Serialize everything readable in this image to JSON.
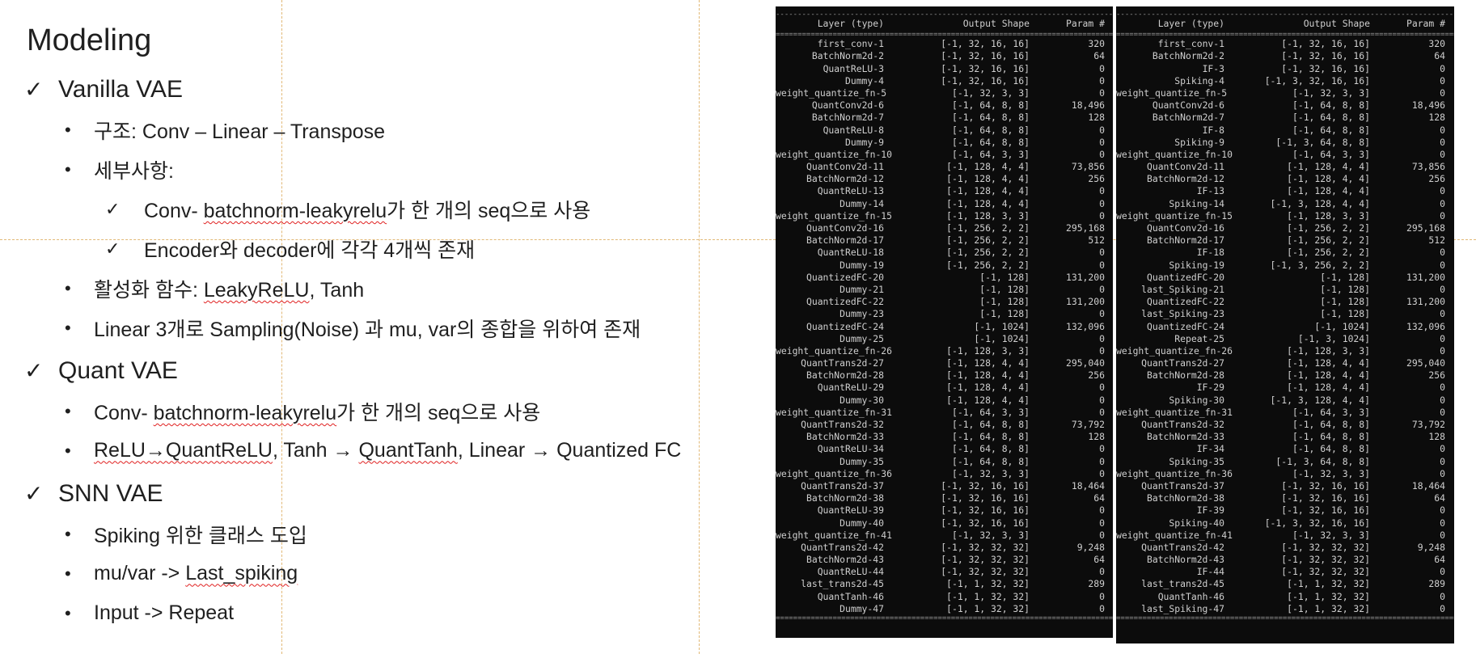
{
  "slide": {
    "title": "Modeling",
    "vanilla": {
      "heading": "Vanilla VAE",
      "structure_label": "구조: Conv – Linear – Transpose",
      "details_label": "세부사항:",
      "detail1_pre": "Conv- ",
      "detail1_sq": "batchnorm-leakyrelu",
      "detail1_post": "가 한 개의 seq으로 사용",
      "detail2": "Encoder와 decoder에 각각 4개씩 존재",
      "activation_pre": "활성화 함수: ",
      "activation_sq": "LeakyReLU",
      "activation_post": ", Tanh",
      "linear": "Linear 3개로  Sampling(Noise) 과 mu, var의 종합을 위하여 존재"
    },
    "quant": {
      "heading": "Quant VAE",
      "item1_pre": "Conv- ",
      "item1_sq": "batchnorm-leakyrelu",
      "item1_post": "가 한 개의 seq으로 사용",
      "item2_sq1": "ReLU→QuantReLU",
      "item2_mid": ", Tanh → ",
      "item2_sq2": "QuantTanh",
      "item2_post": ", Linear → Quantized FC"
    },
    "snn": {
      "heading": "SNN VAE",
      "item1": "Spiking 위한 클래스 도입",
      "item2_pre": "mu/var -> ",
      "item2_sq": "Last_spiking",
      "item3": "Input -> Repeat"
    }
  },
  "icons": {
    "check": "check-icon",
    "bullet": "bullet-icon"
  },
  "term_header": {
    "layer": "Layer (type)",
    "shape": "Output Shape",
    "params": "Param #"
  },
  "term_left": [
    [
      "first_conv-1",
      "[-1, 32, 16, 16]",
      "320"
    ],
    [
      "BatchNorm2d-2",
      "[-1, 32, 16, 16]",
      "64"
    ],
    [
      "QuantReLU-3",
      "[-1, 32, 16, 16]",
      "0"
    ],
    [
      "Dummy-4",
      "[-1, 32, 16, 16]",
      "0"
    ],
    [
      "weight_quantize_fn-5",
      "[-1, 32, 3, 3]",
      "0"
    ],
    [
      "QuantConv2d-6",
      "[-1, 64, 8, 8]",
      "18,496"
    ],
    [
      "BatchNorm2d-7",
      "[-1, 64, 8, 8]",
      "128"
    ],
    [
      "QuantReLU-8",
      "[-1, 64, 8, 8]",
      "0"
    ],
    [
      "Dummy-9",
      "[-1, 64, 8, 8]",
      "0"
    ],
    [
      "weight_quantize_fn-10",
      "[-1, 64, 3, 3]",
      "0"
    ],
    [
      "QuantConv2d-11",
      "[-1, 128, 4, 4]",
      "73,856"
    ],
    [
      "BatchNorm2d-12",
      "[-1, 128, 4, 4]",
      "256"
    ],
    [
      "QuantReLU-13",
      "[-1, 128, 4, 4]",
      "0"
    ],
    [
      "Dummy-14",
      "[-1, 128, 4, 4]",
      "0"
    ],
    [
      "weight_quantize_fn-15",
      "[-1, 128, 3, 3]",
      "0"
    ],
    [
      "QuantConv2d-16",
      "[-1, 256, 2, 2]",
      "295,168"
    ],
    [
      "BatchNorm2d-17",
      "[-1, 256, 2, 2]",
      "512"
    ],
    [
      "QuantReLU-18",
      "[-1, 256, 2, 2]",
      "0"
    ],
    [
      "Dummy-19",
      "[-1, 256, 2, 2]",
      "0"
    ],
    [
      "QuantizedFC-20",
      "[-1, 128]",
      "131,200"
    ],
    [
      "Dummy-21",
      "[-1, 128]",
      "0"
    ],
    [
      "QuantizedFC-22",
      "[-1, 128]",
      "131,200"
    ],
    [
      "Dummy-23",
      "[-1, 128]",
      "0"
    ],
    [
      "QuantizedFC-24",
      "[-1, 1024]",
      "132,096"
    ],
    [
      "Dummy-25",
      "[-1, 1024]",
      "0"
    ],
    [
      "weight_quantize_fn-26",
      "[-1, 128, 3, 3]",
      "0"
    ],
    [
      "QuantTrans2d-27",
      "[-1, 128, 4, 4]",
      "295,040"
    ],
    [
      "BatchNorm2d-28",
      "[-1, 128, 4, 4]",
      "256"
    ],
    [
      "QuantReLU-29",
      "[-1, 128, 4, 4]",
      "0"
    ],
    [
      "Dummy-30",
      "[-1, 128, 4, 4]",
      "0"
    ],
    [
      "weight_quantize_fn-31",
      "[-1, 64, 3, 3]",
      "0"
    ],
    [
      "QuantTrans2d-32",
      "[-1, 64, 8, 8]",
      "73,792"
    ],
    [
      "BatchNorm2d-33",
      "[-1, 64, 8, 8]",
      "128"
    ],
    [
      "QuantReLU-34",
      "[-1, 64, 8, 8]",
      "0"
    ],
    [
      "Dummy-35",
      "[-1, 64, 8, 8]",
      "0"
    ],
    [
      "weight_quantize_fn-36",
      "[-1, 32, 3, 3]",
      "0"
    ],
    [
      "QuantTrans2d-37",
      "[-1, 32, 16, 16]",
      "18,464"
    ],
    [
      "BatchNorm2d-38",
      "[-1, 32, 16, 16]",
      "64"
    ],
    [
      "QuantReLU-39",
      "[-1, 32, 16, 16]",
      "0"
    ],
    [
      "Dummy-40",
      "[-1, 32, 16, 16]",
      "0"
    ],
    [
      "weight_quantize_fn-41",
      "[-1, 32, 3, 3]",
      "0"
    ],
    [
      "QuantTrans2d-42",
      "[-1, 32, 32, 32]",
      "9,248"
    ],
    [
      "BatchNorm2d-43",
      "[-1, 32, 32, 32]",
      "64"
    ],
    [
      "QuantReLU-44",
      "[-1, 32, 32, 32]",
      "0"
    ],
    [
      "last_trans2d-45",
      "[-1, 1, 32, 32]",
      "289"
    ],
    [
      "QuantTanh-46",
      "[-1, 1, 32, 32]",
      "0"
    ],
    [
      "Dummy-47",
      "[-1, 1, 32, 32]",
      "0"
    ]
  ],
  "term_right": [
    [
      "first_conv-1",
      "[-1, 32, 16, 16]",
      "320"
    ],
    [
      "BatchNorm2d-2",
      "[-1, 32, 16, 16]",
      "64"
    ],
    [
      "IF-3",
      "[-1, 32, 16, 16]",
      "0"
    ],
    [
      "Spiking-4",
      "[-1, 3, 32, 16, 16]",
      "0"
    ],
    [
      "weight_quantize_fn-5",
      "[-1, 32, 3, 3]",
      "0"
    ],
    [
      "QuantConv2d-6",
      "[-1, 64, 8, 8]",
      "18,496"
    ],
    [
      "BatchNorm2d-7",
      "[-1, 64, 8, 8]",
      "128"
    ],
    [
      "IF-8",
      "[-1, 64, 8, 8]",
      "0"
    ],
    [
      "Spiking-9",
      "[-1, 3, 64, 8, 8]",
      "0"
    ],
    [
      "weight_quantize_fn-10",
      "[-1, 64, 3, 3]",
      "0"
    ],
    [
      "QuantConv2d-11",
      "[-1, 128, 4, 4]",
      "73,856"
    ],
    [
      "BatchNorm2d-12",
      "[-1, 128, 4, 4]",
      "256"
    ],
    [
      "IF-13",
      "[-1, 128, 4, 4]",
      "0"
    ],
    [
      "Spiking-14",
      "[-1, 3, 128, 4, 4]",
      "0"
    ],
    [
      "weight_quantize_fn-15",
      "[-1, 128, 3, 3]",
      "0"
    ],
    [
      "QuantConv2d-16",
      "[-1, 256, 2, 2]",
      "295,168"
    ],
    [
      "BatchNorm2d-17",
      "[-1, 256, 2, 2]",
      "512"
    ],
    [
      "IF-18",
      "[-1, 256, 2, 2]",
      "0"
    ],
    [
      "Spiking-19",
      "[-1, 3, 256, 2, 2]",
      "0"
    ],
    [
      "QuantizedFC-20",
      "[-1, 128]",
      "131,200"
    ],
    [
      "last_Spiking-21",
      "[-1, 128]",
      "0"
    ],
    [
      "QuantizedFC-22",
      "[-1, 128]",
      "131,200"
    ],
    [
      "last_Spiking-23",
      "[-1, 128]",
      "0"
    ],
    [
      "QuantizedFC-24",
      "[-1, 1024]",
      "132,096"
    ],
    [
      "Repeat-25",
      "[-1, 3, 1024]",
      "0"
    ],
    [
      "weight_quantize_fn-26",
      "[-1, 128, 3, 3]",
      "0"
    ],
    [
      "QuantTrans2d-27",
      "[-1, 128, 4, 4]",
      "295,040"
    ],
    [
      "BatchNorm2d-28",
      "[-1, 128, 4, 4]",
      "256"
    ],
    [
      "IF-29",
      "[-1, 128, 4, 4]",
      "0"
    ],
    [
      "Spiking-30",
      "[-1, 3, 128, 4, 4]",
      "0"
    ],
    [
      "weight_quantize_fn-31",
      "[-1, 64, 3, 3]",
      "0"
    ],
    [
      "QuantTrans2d-32",
      "[-1, 64, 8, 8]",
      "73,792"
    ],
    [
      "BatchNorm2d-33",
      "[-1, 64, 8, 8]",
      "128"
    ],
    [
      "IF-34",
      "[-1, 64, 8, 8]",
      "0"
    ],
    [
      "Spiking-35",
      "[-1, 3, 64, 8, 8]",
      "0"
    ],
    [
      "weight_quantize_fn-36",
      "[-1, 32, 3, 3]",
      "0"
    ],
    [
      "QuantTrans2d-37",
      "[-1, 32, 16, 16]",
      "18,464"
    ],
    [
      "BatchNorm2d-38",
      "[-1, 32, 16, 16]",
      "64"
    ],
    [
      "IF-39",
      "[-1, 32, 16, 16]",
      "0"
    ],
    [
      "Spiking-40",
      "[-1, 3, 32, 16, 16]",
      "0"
    ],
    [
      "weight_quantize_fn-41",
      "[-1, 32, 3, 3]",
      "0"
    ],
    [
      "QuantTrans2d-42",
      "[-1, 32, 32, 32]",
      "9,248"
    ],
    [
      "BatchNorm2d-43",
      "[-1, 32, 32, 32]",
      "64"
    ],
    [
      "IF-44",
      "[-1, 32, 32, 32]",
      "0"
    ],
    [
      "last_trans2d-45",
      "[-1, 1, 32, 32]",
      "289"
    ],
    [
      "QuantTanh-46",
      "[-1, 1, 32, 32]",
      "0"
    ],
    [
      "last_Spiking-47",
      "[-1, 1, 32, 32]",
      "0"
    ]
  ]
}
